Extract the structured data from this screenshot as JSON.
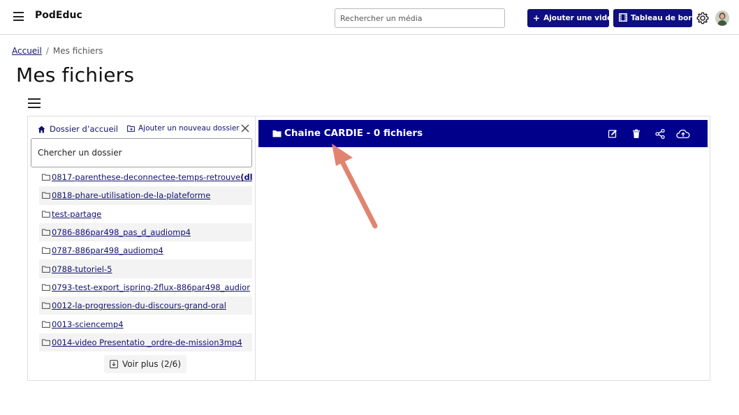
{
  "app": {
    "brand": "PodEduc"
  },
  "header": {
    "search_placeholder": "Rechercher un média",
    "add_video_label": "Ajouter une vidéo",
    "dashboard_label": "Tableau de bord",
    "accent_color": "#0f0f80"
  },
  "breadcrumb": {
    "home": "Accueil",
    "separator": "/",
    "current": "Mes fichiers"
  },
  "page": {
    "title": "Mes fichiers"
  },
  "sidebar": {
    "home_label": "Dossier d’accueil",
    "new_folder_label": "Ajouter un nouveau dossier",
    "search_placeholder": "Chercher un dossier",
    "folders": [
      {
        "label": "0817-parenthese-deconnectee-temps-retrouve",
        "suffix": "(dl"
      },
      {
        "label": "0818-phare-utilisation-de-la-plateforme"
      },
      {
        "label": "test-partage"
      },
      {
        "label": "0786-886par498_pas_d_audiomp4"
      },
      {
        "label": "0787-886par498_audiomp4"
      },
      {
        "label": "0788-tutoriel-5"
      },
      {
        "label": "0793-test-export_ispring-2flux-886par498_audior"
      },
      {
        "label": "0012-la-progression-du-discours-grand-oral"
      },
      {
        "label": "0013-sciencemp4"
      },
      {
        "label": "0014-video Presentatio _ordre-de-mission3mp4"
      }
    ],
    "more_label": "Voir plus (2/6)"
  },
  "channel": {
    "title": "Chaine CARDIE - 0 fichiers",
    "bar_color": "#00008b"
  },
  "icons": [
    "menu-icon",
    "plus-icon",
    "film-icon",
    "gear-icon",
    "avatar",
    "home-icon",
    "folder-add-icon",
    "close-icon",
    "folder-icon",
    "edit-icon",
    "trash-icon",
    "share-icon",
    "cloud-upload-icon",
    "download-box-icon",
    "annotation-arrow"
  ]
}
